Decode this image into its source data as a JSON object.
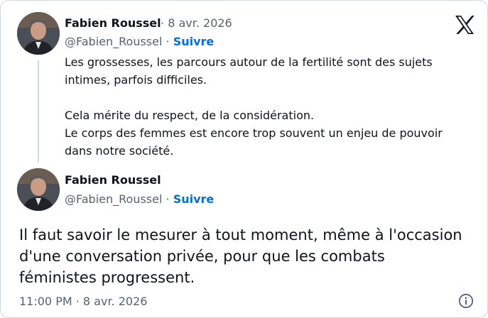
{
  "tweet1": {
    "author_name": "Fabien Roussel",
    "date": "8 avr. 2026",
    "handle": "@Fabien_Roussel",
    "follow_label": "Suivre",
    "lines": [
      "Les grossesses, les parcours autour de la fertilité sont des sujets",
      "intimes, parfois difficiles.",
      "",
      "Cela mérite du respect, de la considération.",
      "Le corps des femmes est encore trop souvent un enjeu de pouvoir",
      "dans notre société."
    ]
  },
  "tweet2": {
    "author_name": "Fabien Roussel",
    "handle": "@Fabien_Roussel",
    "follow_label": "Suivre",
    "lines": [
      "Il faut savoir le mesurer à tout moment, même à l'occasion",
      "d'une conversation privée, pour que les combats",
      "féministes progressent."
    ],
    "timestamp": "11:00 PM · 8 avr. 2026"
  },
  "separator": "·",
  "icons": {
    "brand": "x-logo-icon",
    "info": "info-icon",
    "avatar": "avatar-photo"
  },
  "colors": {
    "text": "#0f1419",
    "secondary": "#536471",
    "follow": "#006fd6",
    "border": "#cfd9de"
  }
}
